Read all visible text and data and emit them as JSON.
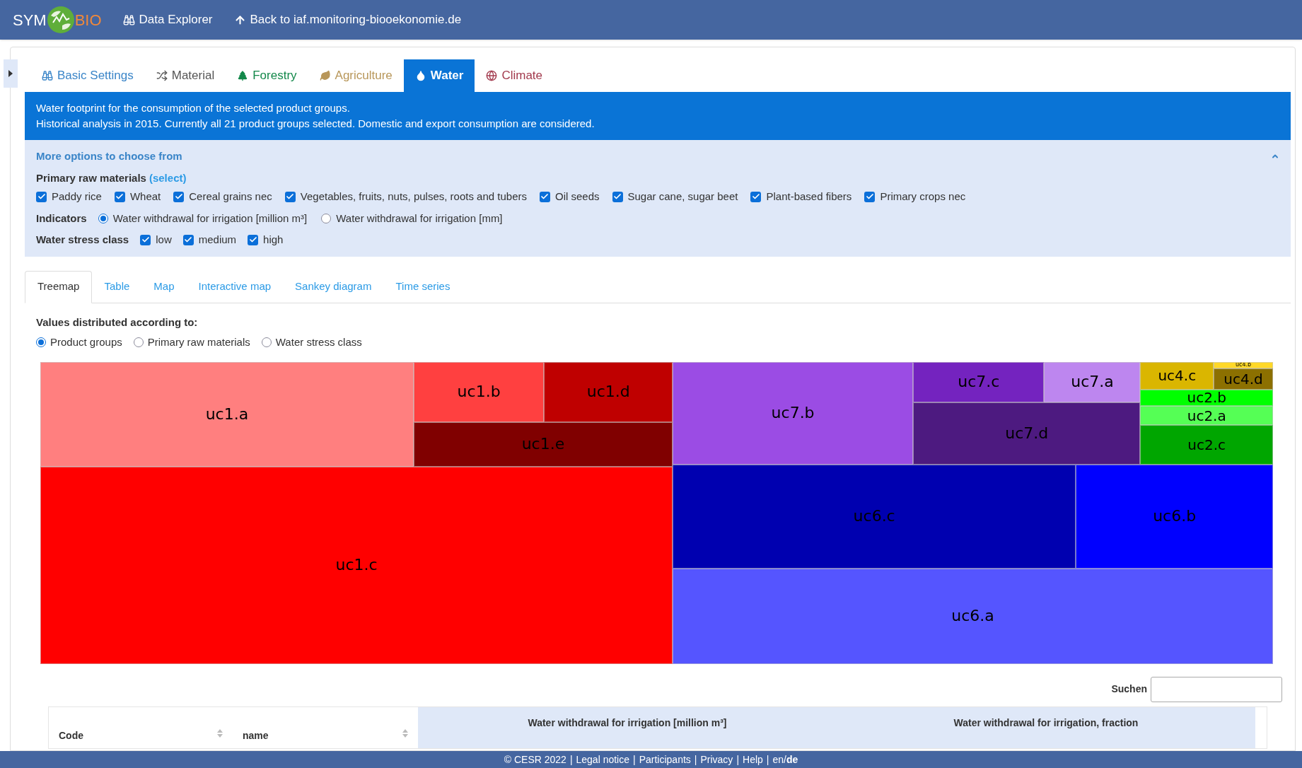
{
  "navbar": {
    "logo_left": "SYM",
    "logo_right": "BIO",
    "links": [
      {
        "label": "Data Explorer",
        "kind": "explorer"
      },
      {
        "label": "Back to iaf.monitoring-biooekonomie.de",
        "kind": "back"
      }
    ]
  },
  "tabs": [
    {
      "label": "Basic Settings",
      "kind": "binoculars",
      "color": "#3a85c8",
      "selected": false
    },
    {
      "label": "Material",
      "kind": "shuffle",
      "color": "#555555",
      "selected": false
    },
    {
      "label": "Forestry",
      "kind": "tree",
      "color": "#13884a",
      "selected": false
    },
    {
      "label": "Agriculture",
      "kind": "leaf",
      "color": "#b8975a",
      "selected": false
    },
    {
      "label": "Water",
      "kind": "drop",
      "color": "#0a74d6",
      "selected": true
    },
    {
      "label": "Climate",
      "kind": "globe",
      "color": "#a23a4d",
      "selected": false
    }
  ],
  "info": [
    "Water footprint for the consumption of the selected product groups.",
    "Historical analysis in 2015. Currently all 21 product groups selected. Domestic and export consumption are considered."
  ],
  "options": {
    "title": "More options to choose from",
    "expanded": true,
    "raw_materials": {
      "label": "Primary raw materials",
      "link": "(select)",
      "items": [
        {
          "label": "Paddy rice",
          "checked": true
        },
        {
          "label": "Wheat",
          "checked": true
        },
        {
          "label": "Cereal grains nec",
          "checked": true
        },
        {
          "label": "Vegetables, fruits, nuts, pulses, roots and tubers",
          "checked": true
        },
        {
          "label": "Oil seeds",
          "checked": true
        },
        {
          "label": "Sugar cane, sugar beet",
          "checked": true
        },
        {
          "label": "Plant-based fibers",
          "checked": true
        },
        {
          "label": "Primary crops nec",
          "checked": true
        }
      ]
    },
    "indicators": {
      "label": "Indicators",
      "items": [
        {
          "label": "Water withdrawal for irrigation [million m³]",
          "selected": true
        },
        {
          "label": "Water withdrawal for irrigation [mm]",
          "selected": false
        }
      ]
    },
    "stress": {
      "label": "Water stress class",
      "items": [
        {
          "label": "low",
          "checked": true
        },
        {
          "label": "medium",
          "checked": true
        },
        {
          "label": "high",
          "checked": true
        }
      ]
    }
  },
  "subtabs": [
    {
      "label": "Treemap",
      "selected": true
    },
    {
      "label": "Table",
      "selected": false
    },
    {
      "label": "Map",
      "selected": false
    },
    {
      "label": "Interactive map",
      "selected": false
    },
    {
      "label": "Sankey diagram",
      "selected": false
    },
    {
      "label": "Time series",
      "selected": false
    }
  ],
  "distribution": {
    "label": "Values distributed according to:",
    "items": [
      {
        "label": "Product groups",
        "selected": true
      },
      {
        "label": "Primary raw materials",
        "selected": false
      },
      {
        "label": "Water stress class",
        "selected": false
      }
    ]
  },
  "treemap": [
    {
      "label": "uc1.a",
      "color": "#ff7f7f"
    },
    {
      "label": "uc1.b",
      "color": "#ff4040"
    },
    {
      "label": "uc1.d",
      "color": "#bf0000"
    },
    {
      "label": "uc1.e",
      "color": "#800000"
    },
    {
      "label": "uc1.c",
      "color": "#ff0000"
    },
    {
      "label": "uc7.b",
      "color": "#9b4ce4"
    },
    {
      "label": "uc7.c",
      "color": "#7423bf"
    },
    {
      "label": "uc7.a",
      "color": "#bd86ef"
    },
    {
      "label": "uc7.d",
      "color": "#4d1a80"
    },
    {
      "label": "uc4.c",
      "color": "#dab600"
    },
    {
      "label": "uc4.b",
      "color": "#ffd827"
    },
    {
      "label": "uc4.d",
      "color": "#8c7000"
    },
    {
      "label": "uc2.b",
      "color": "#00ff00"
    },
    {
      "label": "uc2.a",
      "color": "#55ff55"
    },
    {
      "label": "uc2.c",
      "color": "#00a600"
    },
    {
      "label": "uc6.c",
      "color": "#0000b0"
    },
    {
      "label": "uc6.b",
      "color": "#0000ff"
    },
    {
      "label": "uc6.a",
      "color": "#5555ff"
    }
  ],
  "search": {
    "label": "Suchen"
  },
  "table": {
    "columns": [
      "Code",
      "name"
    ],
    "groups": [
      "Water withdrawal for irrigation [million m³]",
      "Water withdrawal for irrigation, fraction"
    ]
  },
  "footer": {
    "separator": "|",
    "items": [
      "© CESR 2022",
      "Legal notice",
      "Participants",
      "Privacy",
      "Help"
    ],
    "lang_separator": "/",
    "languages": [
      {
        "label": "en",
        "selected": false
      },
      {
        "label": "de",
        "selected": true
      }
    ]
  }
}
